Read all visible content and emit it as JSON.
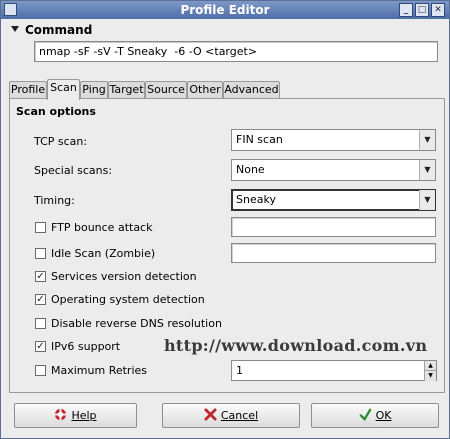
{
  "window": {
    "title": "Profile Editor",
    "buttons": [
      "_",
      "□",
      "✕"
    ]
  },
  "command": {
    "header": "Command",
    "value": "nmap -sF -sV -T Sneaky  -6 -O <target>"
  },
  "tabs": [
    {
      "label": "Profile",
      "active": false
    },
    {
      "label": "Scan",
      "active": true
    },
    {
      "label": "Ping",
      "active": false
    },
    {
      "label": "Target",
      "active": false
    },
    {
      "label": "Source",
      "active": false
    },
    {
      "label": "Other",
      "active": false
    },
    {
      "label": "Advanced",
      "active": false
    }
  ],
  "scan": {
    "title": "Scan options",
    "tcp_scan": {
      "label": "TCP scan:",
      "value": "FIN scan"
    },
    "special_scans": {
      "label": "Special scans:",
      "value": "None"
    },
    "timing": {
      "label": "Timing:",
      "value": "Sneaky"
    },
    "ftp_bounce": {
      "label": "FTP bounce attack",
      "checked": false,
      "value": ""
    },
    "idle_scan": {
      "label": "Idle Scan (Zombie)",
      "checked": false,
      "value": ""
    },
    "services_version": {
      "label": "Services version detection",
      "checked": true
    },
    "os_detection": {
      "label": "Operating system detection",
      "checked": true
    },
    "disable_dns": {
      "label": "Disable reverse DNS resolution",
      "checked": false
    },
    "ipv6": {
      "label": "IPv6 support",
      "checked": true
    },
    "max_retries": {
      "label": "Maximum Retries",
      "checked": false,
      "value": "1"
    }
  },
  "watermark": "http://www.download.com.vn",
  "footer": {
    "help_label": "Help",
    "cancel_label": "Cancel",
    "ok_label": "OK"
  },
  "colors": {
    "titlebar": "#5b78b1",
    "panel": "#ececec",
    "cancel_icon": "#c0262b",
    "ok_icon": "#2e8b2e"
  }
}
